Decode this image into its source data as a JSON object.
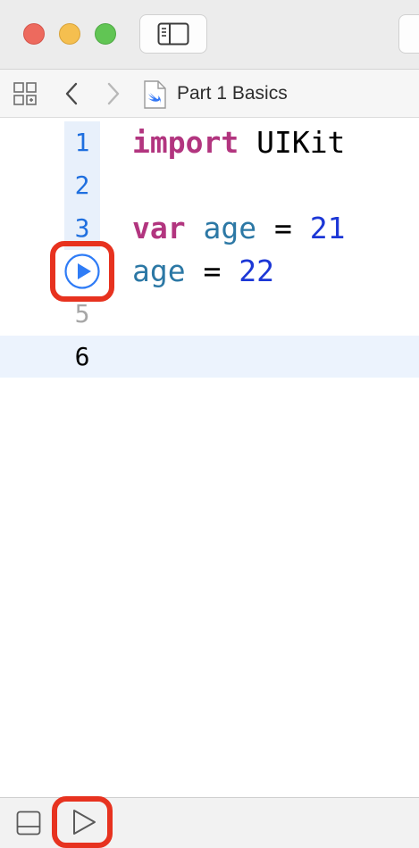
{
  "titlebar": {
    "buttons": [
      "close",
      "minimize",
      "maximize"
    ],
    "sidebar_toggle_icon": "sidebar-icon"
  },
  "jumpbar": {
    "file_title": "Part 1 Basics",
    "icons": [
      "related-items-icon",
      "back-chevron-icon",
      "forward-chevron-icon",
      "swift-file-icon"
    ]
  },
  "editor": {
    "lines": [
      {
        "number": "1",
        "tokens": [
          {
            "text": "import",
            "kind": "keyword"
          },
          {
            "text": " UIKit",
            "kind": "plain"
          }
        ]
      },
      {
        "number": "2",
        "tokens": []
      },
      {
        "number": "3",
        "tokens": [
          {
            "text": "var",
            "kind": "keyword"
          },
          {
            "text": " ",
            "kind": "plain"
          },
          {
            "text": "age",
            "kind": "identifier"
          },
          {
            "text": " = ",
            "kind": "plain"
          },
          {
            "text": "21",
            "kind": "number"
          }
        ]
      },
      {
        "number": "4",
        "tokens": [
          {
            "text": "age",
            "kind": "identifier"
          },
          {
            "text": " = ",
            "kind": "plain"
          },
          {
            "text": "22",
            "kind": "number"
          }
        ]
      },
      {
        "number": "5",
        "tokens": []
      },
      {
        "number": "6",
        "tokens": []
      }
    ],
    "current_line": "6",
    "run_line_button_icon": "play-circle-icon"
  },
  "bottombar": {
    "icons": [
      "debug-area-toggle-icon",
      "run-playground-icon"
    ]
  },
  "colors": {
    "keyword": "#b2357f",
    "identifier": "#2c78a5",
    "number": "#1c37d6",
    "line_number": "#1f6fdf",
    "highlight_annotation": "#e7321f"
  }
}
